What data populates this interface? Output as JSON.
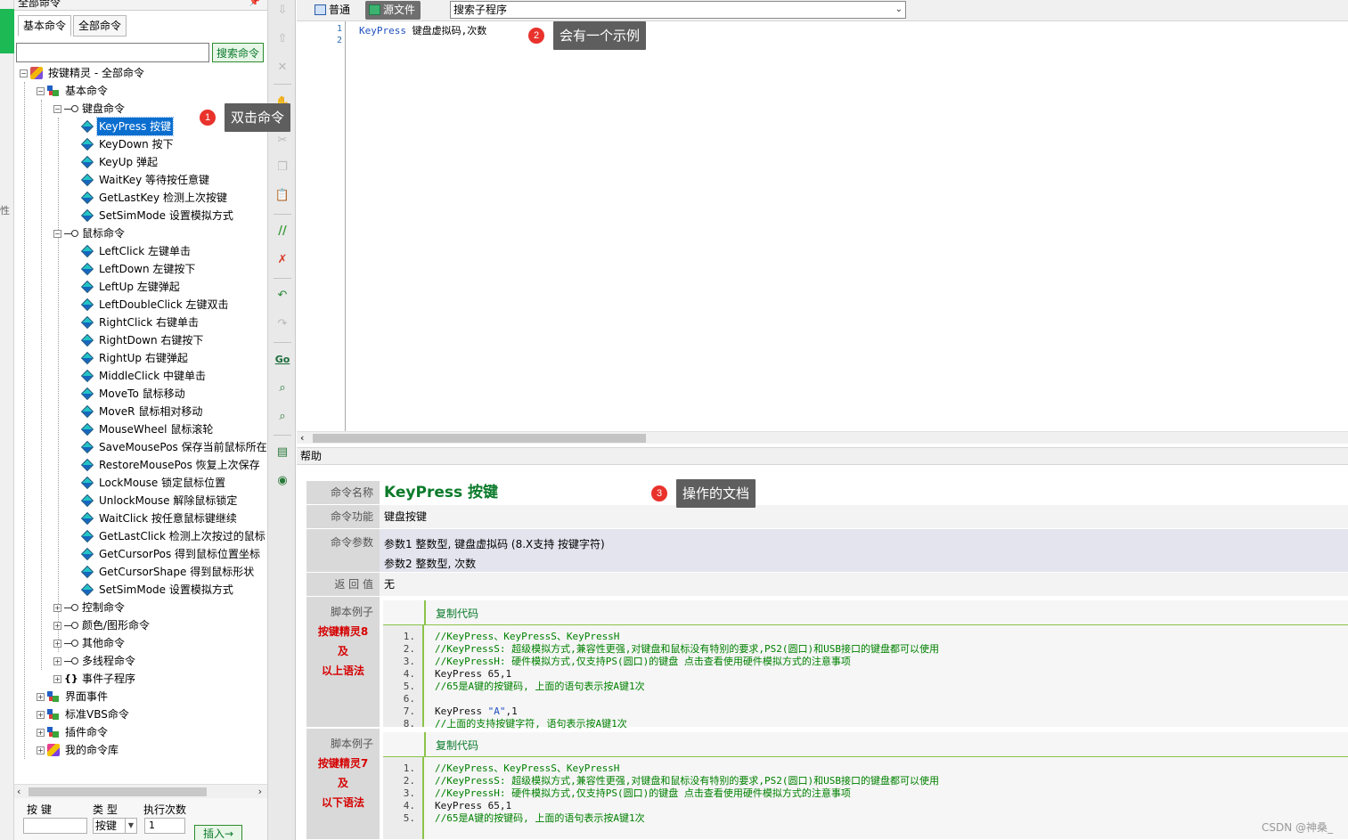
{
  "panel": {
    "title": "全部命令",
    "pin": "📌",
    "tabs": [
      "基本命令",
      "全部命令"
    ],
    "search_value": "",
    "search_button": "搜索命令"
  },
  "tree": {
    "root": "按键精灵 - 全部命令",
    "basic": "基本命令",
    "keyboard": "键盘命令",
    "keyboard_items": [
      "KeyPress 按键",
      "KeyDown 按下",
      "KeyUp 弹起",
      "WaitKey 等待按任意键",
      "GetLastKey 检测上次按键",
      "SetSimMode 设置模拟方式"
    ],
    "mouse": "鼠标命令",
    "mouse_items": [
      "LeftClick 左键单击",
      "LeftDown 左键按下",
      "LeftUp 左键弹起",
      "LeftDoubleClick 左键双击",
      "RightClick 右键单击",
      "RightDown 右键按下",
      "RightUp 右键弹起",
      "MiddleClick 中键单击",
      "MoveTo 鼠标移动",
      "MoveR 鼠标相对移动",
      "MouseWheel 鼠标滚轮",
      "SaveMousePos 保存当前鼠标所在",
      "RestoreMousePos 恢复上次保存",
      "LockMouse 锁定鼠标位置",
      "UnlockMouse 解除鼠标锁定",
      "WaitClick 按任意鼠标键继续",
      "GetLastClick 检测上次按过的鼠标",
      "GetCursorPos 得到鼠标位置坐标",
      "GetCursorShape 得到鼠标形状",
      "SetSimMode 设置模拟方式"
    ],
    "control": "控制命令",
    "color": "颜色/图形命令",
    "other": "其他命令",
    "thread": "多线程命令",
    "event_sub": "事件子程序",
    "ui_event": "界面事件",
    "vbs": "标准VBS命令",
    "plugin": "插件命令",
    "mylib": "我的命令库",
    "selected": "KeyPress 按键"
  },
  "bottom": {
    "param_label": "按 键",
    "type_label": "类 型",
    "count_label": "执行次数",
    "param_value": "",
    "type_value": "按键",
    "count_value": "1",
    "insert_button": "插入→"
  },
  "editor": {
    "mode_normal": "普通",
    "mode_source": "源文件",
    "subproc_placeholder": "搜索子程序",
    "line_numbers": [
      "1",
      "2"
    ],
    "code_keyword": "KeyPress",
    "code_rest": " 键盘虚拟码,次数"
  },
  "help": {
    "header": "帮助",
    "labels": {
      "name": "命令名称",
      "function": "命令功能",
      "params": "命令参数",
      "return": "返 回 值",
      "example": "脚本例子"
    },
    "cmd_name": "KeyPress 按键",
    "cmd_function": "键盘按键",
    "param1": "参数1 整数型, 键盘虚拟码 (8.X支持 按键字符)",
    "param2": "参数2 整数型, 次数",
    "return_value": "无",
    "example1_note1": "按键精灵8及",
    "example1_note2": "以上语法",
    "example2_note1": "按键精灵7及",
    "example2_note2": "以下语法",
    "copy_code": "复制代码",
    "example1_lines": [
      {
        "n": "1.",
        "t": "//KeyPress、KeyPressS、KeyPressH",
        "c": true
      },
      {
        "n": "2.",
        "t": "//KeyPressS: 超级模拟方式,兼容性更强,对键盘和鼠标没有特别的要求,PS2(圆口)和USB接口的键盘都可以使用",
        "c": true
      },
      {
        "n": "3.",
        "t": "//KeyPressH: 硬件模拟方式,仅支持PS(圆口)的键盘 点击查看使用硬件模拟方式的注意事项",
        "c": true
      },
      {
        "n": "4.",
        "t": "KeyPress 65,1",
        "c": false
      },
      {
        "n": "5.",
        "t": "//65是A键的按键码, 上面的语句表示按A键1次",
        "c": true
      },
      {
        "n": "6.",
        "t": "",
        "c": false
      },
      {
        "n": "7.",
        "t": "KeyPress \"A\",1",
        "c": false
      },
      {
        "n": "8.",
        "t": "//上面的支持按键字符, 语句表示按A键1次",
        "c": true
      }
    ],
    "example2_lines": [
      {
        "n": "1.",
        "t": "//KeyPress、KeyPressS、KeyPressH",
        "c": true
      },
      {
        "n": "2.",
        "t": "//KeyPressS: 超级模拟方式,兼容性更强,对键盘和鼠标没有特别的要求,PS2(圆口)和USB接口的键盘都可以使用",
        "c": true
      },
      {
        "n": "3.",
        "t": "//KeyPressH: 硬件模拟方式,仅支持PS(圆口)的键盘 点击查看使用硬件模拟方式的注意事项",
        "c": true
      },
      {
        "n": "4.",
        "t": "KeyPress 65,1",
        "c": false
      },
      {
        "n": "5.",
        "t": "//65是A键的按键码, 上面的语句表示按A键1次",
        "c": true
      }
    ]
  },
  "annotations": {
    "badge1": "1",
    "callout1": "双击命令",
    "badge2": "2",
    "callout2": "会有一个示例",
    "badge3": "3",
    "callout3": "操作的文档"
  },
  "left_strip_char": "性",
  "watermark": "CSDN @神桑_",
  "colors": {
    "accent_green": "#1db954",
    "selection_blue": "#0a6ecf",
    "command_name_green": "#0a7a2a",
    "comment_green": "#008000",
    "badge_red": "#e8322b",
    "callout_gray": "#5e5e5e"
  }
}
